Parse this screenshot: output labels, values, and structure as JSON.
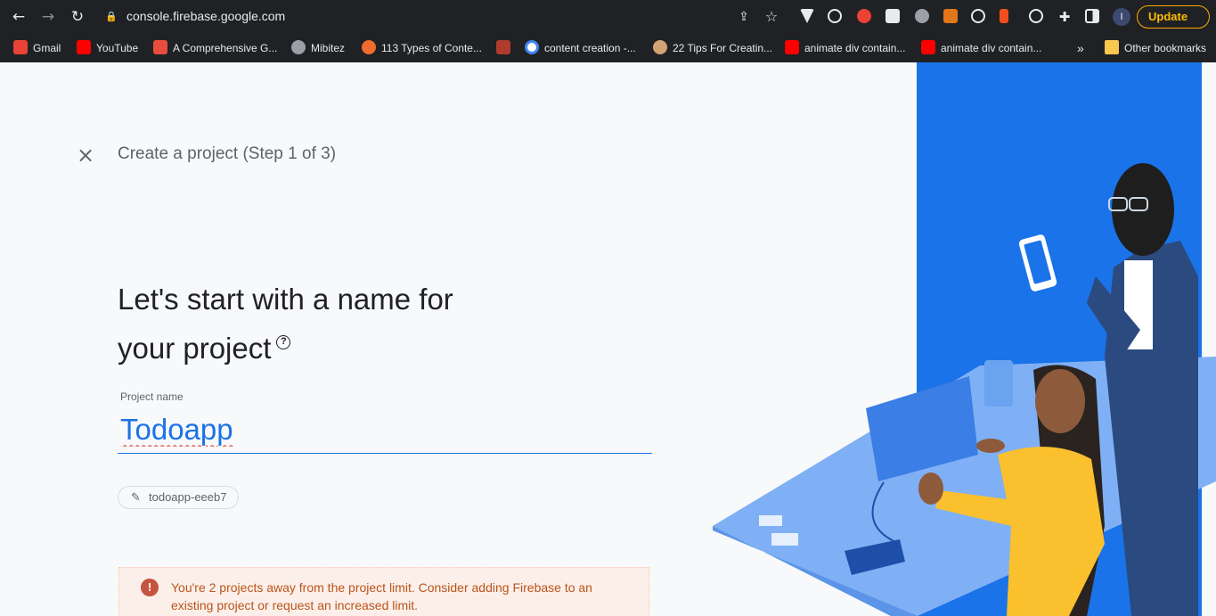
{
  "browser": {
    "url": "console.firebase.google.com",
    "update_label": "Update",
    "avatar_letter": "I",
    "bookmarks": [
      {
        "label": "Gmail",
        "color": "#ea4335"
      },
      {
        "label": "YouTube",
        "color": "#ff0000"
      },
      {
        "label": "A Comprehensive G...",
        "color": "#e74c3c"
      },
      {
        "label": "Mibitez",
        "color": "#9aa0a6"
      },
      {
        "label": "113 Types of Conte...",
        "color": "#f26b2e"
      },
      {
        "label": "",
        "color": "#b03a2e"
      },
      {
        "label": "content creation -...",
        "color": "#4285f4"
      },
      {
        "label": "22 Tips For Creatin...",
        "color": "#d4a373"
      },
      {
        "label": "animate div contain...",
        "color": "#ff0000"
      },
      {
        "label": "animate div contain...",
        "color": "#ff0000"
      }
    ],
    "overflow_label": "»",
    "other_bookmarks_label": "Other bookmarks"
  },
  "page": {
    "step_title": "Create a project (Step 1 of 3)",
    "headline_line1": "Let's start with a name for",
    "headline_line2": "your project",
    "help_glyph": "?",
    "field_label": "Project name",
    "project_name": "Todoapp",
    "project_id": "todoapp-eeeb7",
    "alert_glyph": "!",
    "alert_text": "You're 2 projects away from the project limit. Consider adding Firebase to an existing project or request an increased limit."
  },
  "colors": {
    "accent": "#1a73e8",
    "panel_blue": "#1a73e8",
    "warning": "#b9541b"
  }
}
